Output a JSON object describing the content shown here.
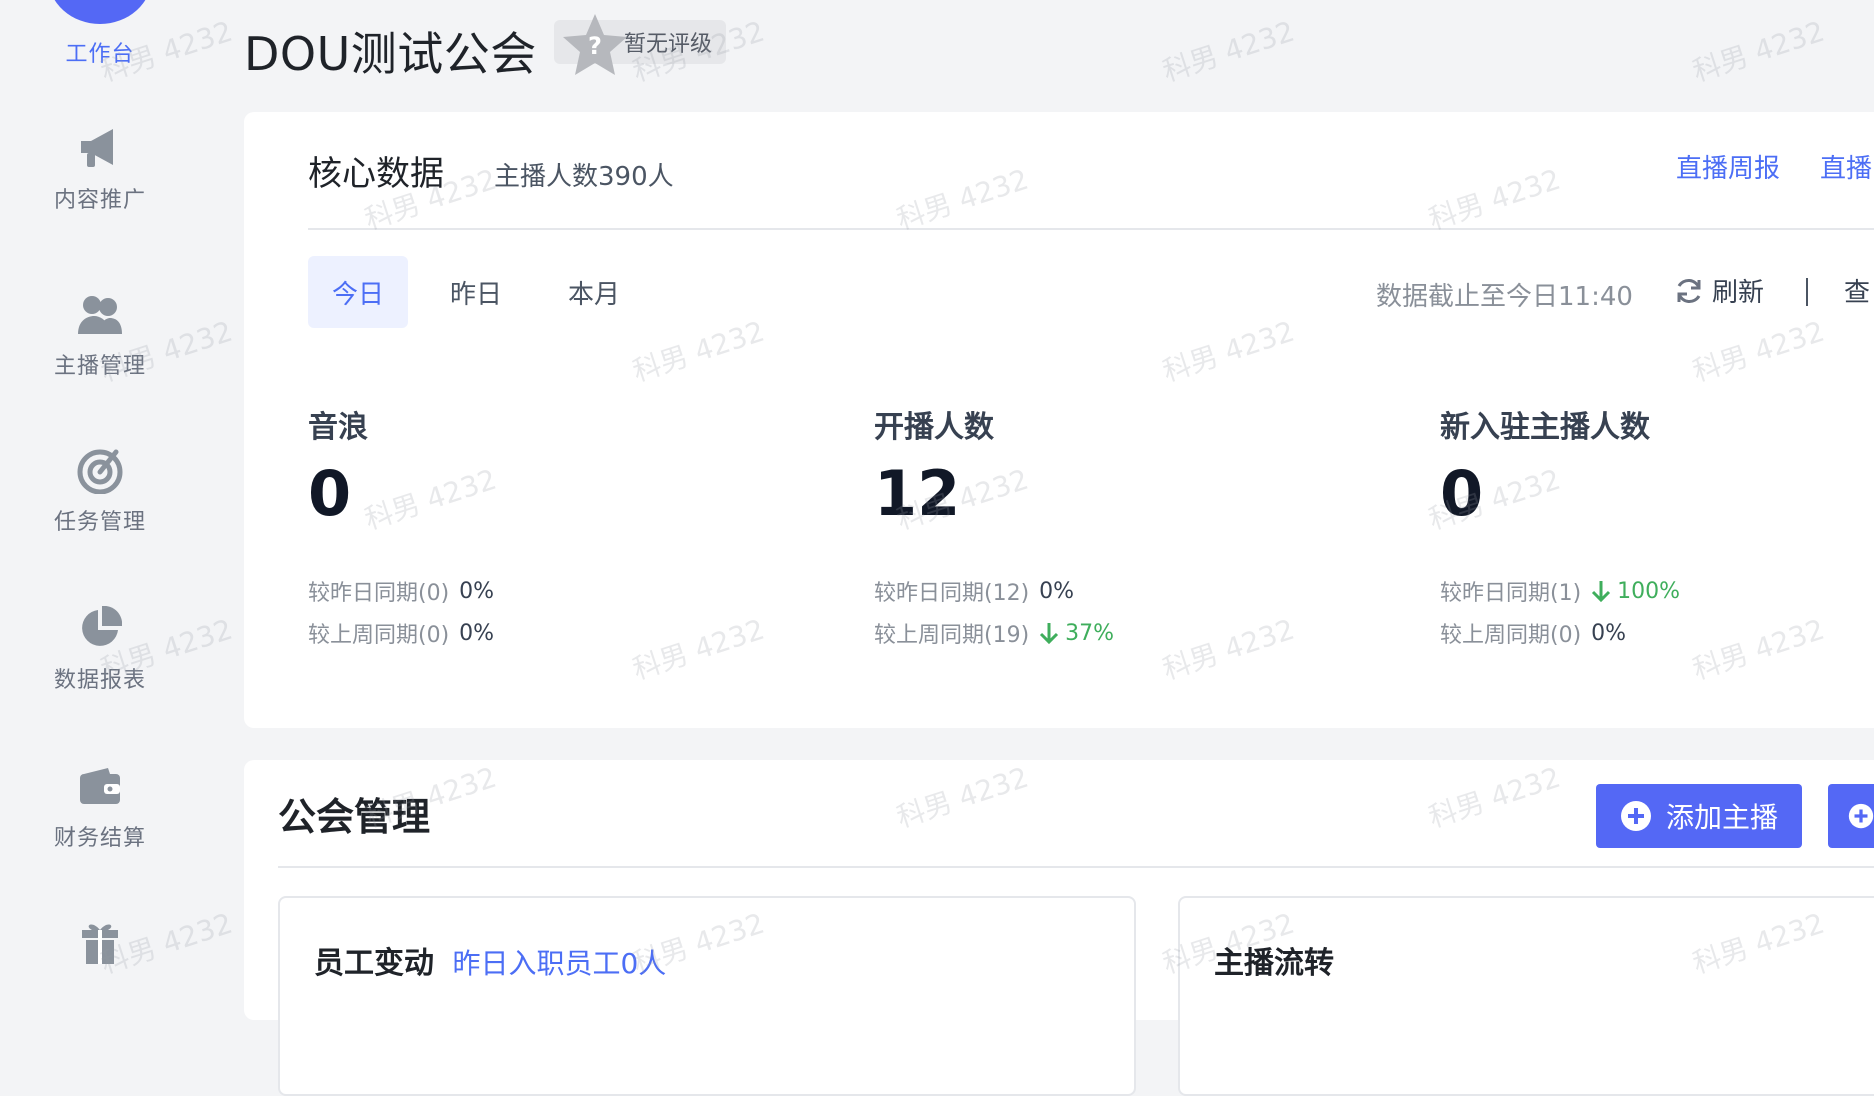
{
  "sidebar": {
    "items": [
      {
        "label": "工作台",
        "icon": "workbench-icon",
        "active": true
      },
      {
        "label": "内容推广",
        "icon": "megaphone-icon",
        "active": false
      },
      {
        "label": "主播管理",
        "icon": "people-icon",
        "active": false
      },
      {
        "label": "任务管理",
        "icon": "target-icon",
        "active": false
      },
      {
        "label": "数据报表",
        "icon": "pie-chart-icon",
        "active": false
      },
      {
        "label": "财务结算",
        "icon": "wallet-icon",
        "active": false
      },
      {
        "label": "",
        "icon": "gift-icon",
        "active": false
      }
    ]
  },
  "header": {
    "guild_name": "DOU测试公会",
    "rating_label": "暂无评级"
  },
  "core": {
    "title": "核心数据",
    "subtitle": "主播人数390人",
    "links": [
      "直播周报",
      "直播"
    ],
    "tabs": [
      "今日",
      "昨日",
      "本月"
    ],
    "active_tab": "今日",
    "update_time": "数据截止至今日11:40",
    "refresh_label": "刷新",
    "more_label": "查",
    "metrics": [
      {
        "label": "音浪",
        "value": "0",
        "compare": [
          {
            "label": "较昨日同期(0)",
            "value": "0%",
            "trend": "none"
          },
          {
            "label": "较上周同期(0)",
            "value": "0%",
            "trend": "none"
          }
        ]
      },
      {
        "label": "开播人数",
        "value": "12",
        "compare": [
          {
            "label": "较昨日同期(12)",
            "value": "0%",
            "trend": "none"
          },
          {
            "label": "较上周同期(19)",
            "value": "37%",
            "trend": "down"
          }
        ]
      },
      {
        "label": "新入驻主播人数",
        "value": "0",
        "compare": [
          {
            "label": "较昨日同期(1)",
            "value": "100%",
            "trend": "down"
          },
          {
            "label": "较上周同期(0)",
            "value": "0%",
            "trend": "none"
          }
        ]
      }
    ]
  },
  "guild_mgmt": {
    "title": "公会管理",
    "add_anchor_label": "添加主播",
    "staff_title": "员工变动",
    "staff_link": "昨日入职员工0人",
    "anchor_flow_title": "主播流转"
  },
  "watermark": "科男 4232",
  "colors": {
    "accent": "#4c6ef5",
    "primary_button": "#5468f5",
    "down_trend": "#3fae5c"
  }
}
